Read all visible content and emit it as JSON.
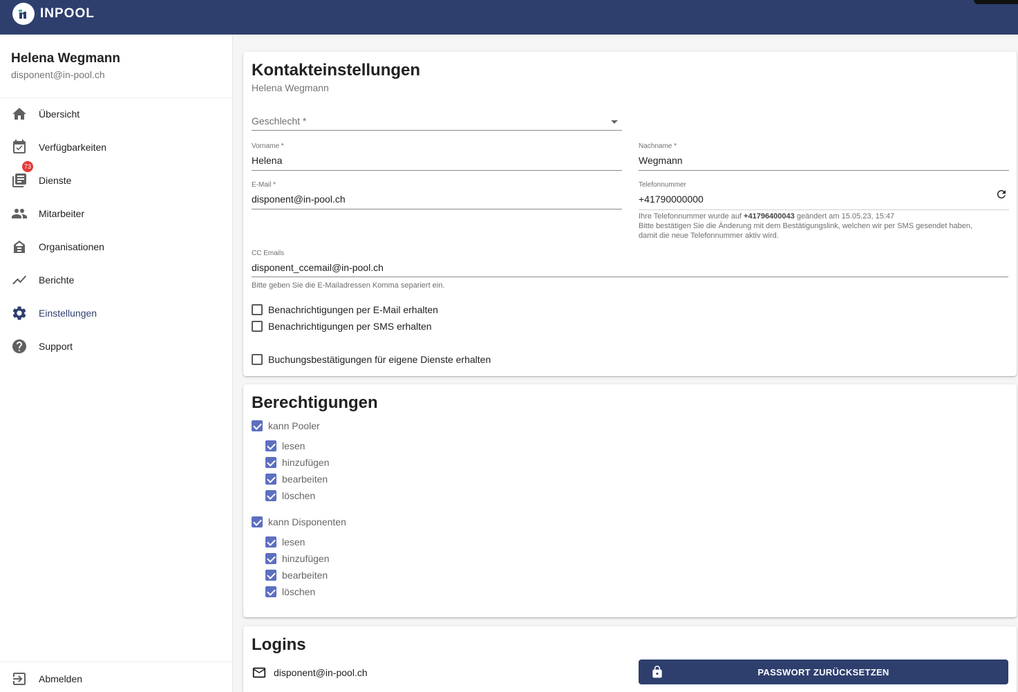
{
  "brand": {
    "name": "INPOOL",
    "color": "#2e3f6e"
  },
  "sidebar": {
    "user_name": "Helena Wegmann",
    "user_email": "disponent@in-pool.ch",
    "items": [
      {
        "label": "Übersicht",
        "icon": "home-icon"
      },
      {
        "label": "Verfügbarkeiten",
        "icon": "calendar-check-icon"
      },
      {
        "label": "Dienste",
        "icon": "list-icon",
        "badge": "73"
      },
      {
        "label": "Mitarbeiter",
        "icon": "people-icon"
      },
      {
        "label": "Organisationen",
        "icon": "building-icon"
      },
      {
        "label": "Berichte",
        "icon": "trending-icon"
      },
      {
        "label": "Einstellungen",
        "icon": "gear-icon",
        "active": true
      },
      {
        "label": "Support",
        "icon": "help-icon"
      }
    ],
    "logout_label": "Abmelden"
  },
  "contact": {
    "title": "Kontakteinstellungen",
    "subtitle": "Helena Wegmann",
    "gender": {
      "placeholder": "Geschlecht *"
    },
    "firstname": {
      "label": "Vorname *",
      "value": "Helena"
    },
    "lastname": {
      "label": "Nachname *",
      "value": "Wegmann"
    },
    "email": {
      "label": "E-Mail *",
      "value": "disponent@in-pool.ch"
    },
    "phone": {
      "label": "Telefonnummer",
      "value": "+41790000000",
      "hint_prefix": "Ihre Telefonnummer wurde auf ",
      "hint_number": "+41796400043",
      "hint_suffix": " geändert am 15.05.23, 15:47",
      "hint_line2": "Bitte bestätigen Sie die Änderung mit dem Bestätigungslink, welchen wir per SMS gesendet haben,",
      "hint_line3": "damit die neue Telefonnummer aktiv wird."
    },
    "cc": {
      "label": "CC Emails",
      "value": "disponent_ccemail@in-pool.ch",
      "hint": "Bitte geben Sie die E-Mailadressen Komma separiert ein."
    },
    "checkboxes": {
      "email_notify": "Benachrichtigungen per E-Mail erhalten",
      "sms_notify": "Benachrichtigungen per SMS erhalten",
      "booking_confirm": "Buchungsbestätigungen für eigene Dienste erhalten"
    }
  },
  "permissions": {
    "title": "Berechtigungen",
    "groups": [
      {
        "label": "kann Pooler",
        "items": [
          "lesen",
          "hinzufügen",
          "bearbeiten",
          "löschen"
        ]
      },
      {
        "label": "kann Disponenten",
        "items": [
          "lesen",
          "hinzufügen",
          "bearbeiten",
          "löschen"
        ]
      }
    ]
  },
  "logins": {
    "title": "Logins",
    "email": "disponent@in-pool.ch",
    "reset_label": "PASSWORT ZURÜCKSETZEN"
  }
}
